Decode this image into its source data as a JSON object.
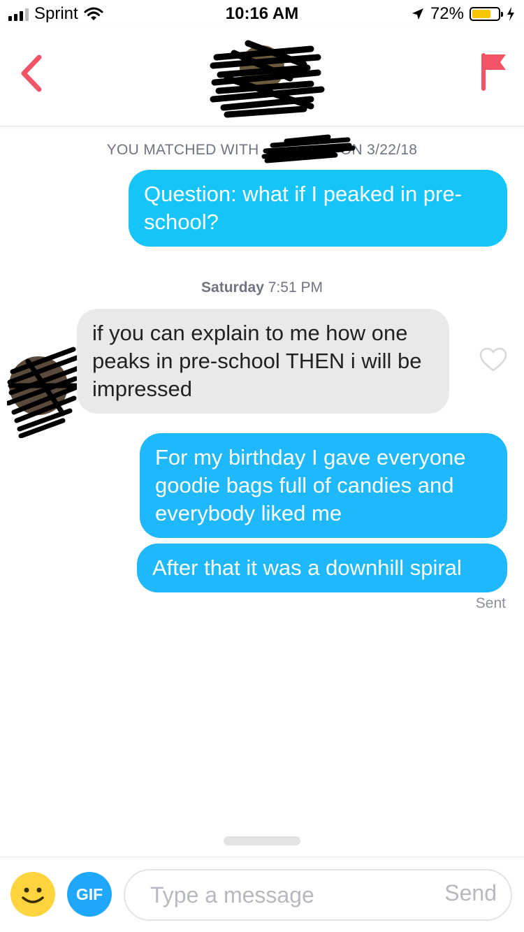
{
  "status_bar": {
    "carrier": "Sprint",
    "time": "10:16 AM",
    "battery_percent": "72%",
    "battery_level": 0.72,
    "icons": [
      "signal-bars-icon",
      "wifi-icon",
      "location-arrow-icon",
      "battery-icon",
      "charging-bolt-icon"
    ]
  },
  "header": {
    "back_icon": "chevron-left-icon",
    "report_icon": "flag-icon",
    "avatar": "redacted-profile-photo",
    "accent_color": "#f25466"
  },
  "chat": {
    "match_notice_prefix": "YOU MATCHED WITH",
    "match_notice_suffix": "ON 3/22/18",
    "messages": [
      {
        "direction": "sent",
        "text": "Question: what if I peaked in pre-school?"
      },
      {
        "direction": "received",
        "text": "if you can explain to me how one peaks in pre-school THEN i will be impressed"
      },
      {
        "direction": "sent",
        "text": "For my birthday I gave everyone goodie bags full of candies and everybody liked me"
      },
      {
        "direction": "sent",
        "text": "After that it was a downhill spiral"
      }
    ],
    "date_day": "Saturday",
    "date_time": "7:51 PM",
    "delivery_status": "Sent",
    "like_icon": "heart-outline-icon",
    "colors": {
      "sent_bubble_light": "#15c4f9",
      "sent_bubble": "#1fb8fb",
      "received_bubble": "#e9e9ec"
    }
  },
  "composer": {
    "emoji_icon": "smiley-icon",
    "gif_label": "GIF",
    "placeholder": "Type a message",
    "value": "",
    "send_label": "Send"
  }
}
